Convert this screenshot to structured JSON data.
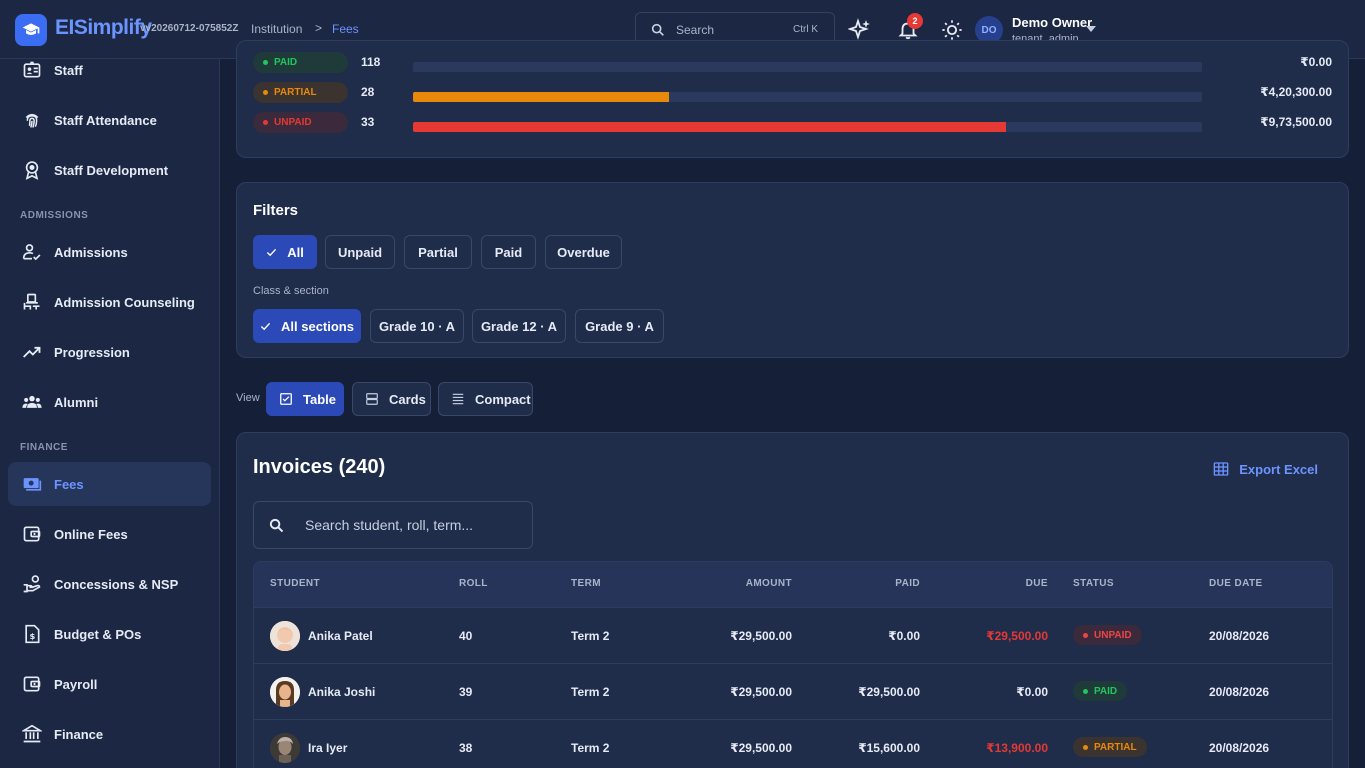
{
  "header": {
    "brand": "EISimplify",
    "version": "vv20260712-075852Z",
    "breadcrumb": [
      "Institution",
      "Fees"
    ],
    "breadcrumb_sep": ">",
    "search": {
      "placeholder": "Search",
      "shortcut": "Ctrl K"
    },
    "notification_count": "2",
    "user": {
      "initials": "DO",
      "name": "Demo Owner",
      "role": "tenant_admin"
    }
  },
  "sidebar": {
    "items": [
      {
        "label": "Staff",
        "icon": "staff-badge-icon"
      },
      {
        "label": "Staff Attendance",
        "icon": "fingerprint-icon"
      },
      {
        "label": "Staff Development",
        "icon": "award-icon"
      },
      {
        "label": "Admissions",
        "icon": "user-check-icon"
      },
      {
        "label": "Admission Counseling",
        "icon": "counseling-icon"
      },
      {
        "label": "Progression",
        "icon": "trending-up-icon"
      },
      {
        "label": "Alumni",
        "icon": "group-icon"
      },
      {
        "label": "Fees",
        "icon": "money-icon",
        "active": true
      },
      {
        "label": "Online Fees",
        "icon": "wallet-icon"
      },
      {
        "label": "Concessions & NSP",
        "icon": "hand-coin-icon"
      },
      {
        "label": "Budget & POs",
        "icon": "budget-icon"
      },
      {
        "label": "Payroll",
        "icon": "payroll-icon"
      },
      {
        "label": "Finance",
        "icon": "bank-icon"
      }
    ],
    "sections": {
      "admissions": "ADMISSIONS",
      "finance": "FINANCE"
    }
  },
  "summary": {
    "rows": [
      {
        "status": "PAID",
        "count": "118",
        "fraction": 0.0,
        "amount": "₹0.00",
        "color": "#22c55e"
      },
      {
        "status": "PARTIAL",
        "count": "28",
        "fraction": 0.325,
        "amount": "₹4,20,300.00",
        "color": "#e8890c"
      },
      {
        "status": "UNPAID",
        "count": "33",
        "fraction": 0.752,
        "amount": "₹9,73,500.00",
        "color": "#e53935"
      }
    ]
  },
  "filters": {
    "title": "Filters",
    "status_chips": [
      {
        "label": "All",
        "selected": true
      },
      {
        "label": "Unpaid",
        "selected": false
      },
      {
        "label": "Partial",
        "selected": false
      },
      {
        "label": "Paid",
        "selected": false
      },
      {
        "label": "Overdue",
        "selected": false
      }
    ],
    "class_label": "Class & section",
    "class_chips": [
      {
        "label": "All sections",
        "selected": true
      },
      {
        "label": "Grade 10 · A",
        "selected": false
      },
      {
        "label": "Grade 12 · A",
        "selected": false
      },
      {
        "label": "Grade 9 · A",
        "selected": false
      }
    ]
  },
  "view": {
    "label": "View",
    "options": [
      {
        "label": "Table",
        "icon": "table-icon",
        "selected": true
      },
      {
        "label": "Cards",
        "icon": "cards-icon",
        "selected": false
      },
      {
        "label": "Compact",
        "icon": "compact-list-icon",
        "selected": false
      }
    ]
  },
  "invoices": {
    "title": "Invoices",
    "count": "(240)",
    "export_label": "Export Excel",
    "search_placeholder": "Search student, roll, term...",
    "columns": [
      "STUDENT",
      "ROLL",
      "TERM",
      "AMOUNT",
      "PAID",
      "DUE",
      "STATUS",
      "DUE DATE"
    ],
    "rows": [
      {
        "student": "Anika Patel",
        "roll": "40",
        "term": "Term 2",
        "amount": "₹29,500.00",
        "paid": "₹0.00",
        "due": "₹29,500.00",
        "due_red": true,
        "status": "UNPAID",
        "due_date": "20/08/2026"
      },
      {
        "student": "Anika Joshi",
        "roll": "39",
        "term": "Term 2",
        "amount": "₹29,500.00",
        "paid": "₹29,500.00",
        "due": "₹0.00",
        "due_red": false,
        "status": "PAID",
        "due_date": "20/08/2026"
      },
      {
        "student": "Ira Iyer",
        "roll": "38",
        "term": "Term 2",
        "amount": "₹29,500.00",
        "paid": "₹15,600.00",
        "due": "₹13,900.00",
        "due_red": true,
        "status": "PARTIAL",
        "due_date": "20/08/2026"
      }
    ]
  },
  "colors": {
    "accent": "#6c94ff",
    "primary_button": "#2b4ab8",
    "paid": "#22c55e",
    "partial": "#e8890c",
    "unpaid": "#e53935"
  }
}
